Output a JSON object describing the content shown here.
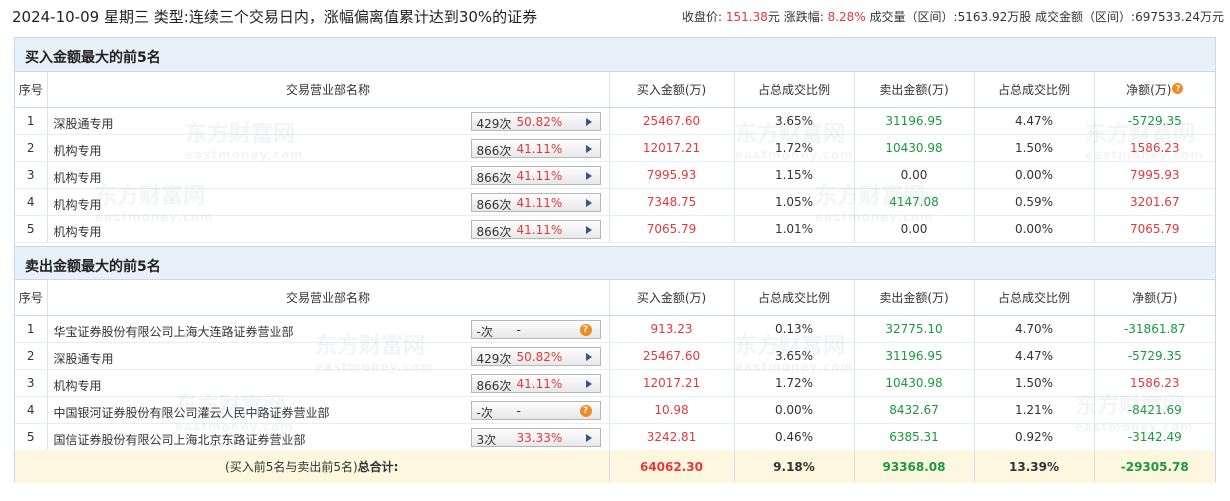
{
  "header": {
    "date": "2024-10-09",
    "weekday": "星期三",
    "type_label": "类型:",
    "type_text": "连续三个交易日内，涨幅偏离值累计达到30%的证券",
    "close_label": "收盘价:",
    "close_value": "151.38",
    "close_unit": "元",
    "change_label": "涨跌幅:",
    "change_value": "8.28%",
    "volume_label": "成交量（区间）:",
    "volume_value": "5163.92万股",
    "amount_label": "成交金额（区间）:",
    "amount_value": "697533.24万元"
  },
  "columns": {
    "index": "序号",
    "name": "交易营业部名称",
    "buy": "买入金额(万)",
    "buy_ratio": "占总成交比例",
    "sell": "卖出金额(万)",
    "sell_ratio": "占总成交比例",
    "net_buy_table": "净额(万)",
    "net_sell_table": "净额(万)"
  },
  "buy_section": {
    "title": "买入金额最大的前5名",
    "rows": [
      {
        "idx": "1",
        "name": "深股通专用",
        "count": "429次",
        "rate": "50.82%",
        "buy": "25467.60",
        "buy_ratio": "3.65%",
        "sell": "31196.95",
        "sell_ratio": "4.47%",
        "net": "-5729.35"
      },
      {
        "idx": "2",
        "name": "机构专用",
        "count": "866次",
        "rate": "41.11%",
        "buy": "12017.21",
        "buy_ratio": "1.72%",
        "sell": "10430.98",
        "sell_ratio": "1.50%",
        "net": "1586.23"
      },
      {
        "idx": "3",
        "name": "机构专用",
        "count": "866次",
        "rate": "41.11%",
        "buy": "7995.93",
        "buy_ratio": "1.15%",
        "sell": "0.00",
        "sell_ratio": "0.00%",
        "net": "7995.93"
      },
      {
        "idx": "4",
        "name": "机构专用",
        "count": "866次",
        "rate": "41.11%",
        "buy": "7348.75",
        "buy_ratio": "1.05%",
        "sell": "4147.08",
        "sell_ratio": "0.59%",
        "net": "3201.67"
      },
      {
        "idx": "5",
        "name": "机构专用",
        "count": "866次",
        "rate": "41.11%",
        "buy": "7065.79",
        "buy_ratio": "1.01%",
        "sell": "0.00",
        "sell_ratio": "0.00%",
        "net": "7065.79"
      }
    ]
  },
  "sell_section": {
    "title": "卖出金额最大的前5名",
    "rows": [
      {
        "idx": "1",
        "name": "华宝证券股份有限公司上海大连路证券营业部",
        "count": "-次",
        "rate": "-",
        "buy": "913.23",
        "buy_ratio": "0.13%",
        "sell": "32775.10",
        "sell_ratio": "4.70%",
        "net": "-31861.87"
      },
      {
        "idx": "2",
        "name": "深股通专用",
        "count": "429次",
        "rate": "50.82%",
        "buy": "25467.60",
        "buy_ratio": "3.65%",
        "sell": "31196.95",
        "sell_ratio": "4.47%",
        "net": "-5729.35"
      },
      {
        "idx": "3",
        "name": "机构专用",
        "count": "866次",
        "rate": "41.11%",
        "buy": "12017.21",
        "buy_ratio": "1.72%",
        "sell": "10430.98",
        "sell_ratio": "1.50%",
        "net": "1586.23"
      },
      {
        "idx": "4",
        "name": "中国银河证券股份有限公司灌云人民中路证券营业部",
        "count": "-次",
        "rate": "-",
        "buy": "10.98",
        "buy_ratio": "0.00%",
        "sell": "8432.67",
        "sell_ratio": "1.21%",
        "net": "-8421.69"
      },
      {
        "idx": "5",
        "name": "国信证券股份有限公司上海北京东路证券营业部",
        "count": "3次",
        "rate": "33.33%",
        "buy": "3242.81",
        "buy_ratio": "0.46%",
        "sell": "6385.31",
        "sell_ratio": "0.92%",
        "net": "-3142.49"
      }
    ]
  },
  "total": {
    "label_prefix": "(买入前5名与卖出前5名)",
    "label_bold": "总合计:",
    "buy": "64062.30",
    "buy_ratio": "9.18%",
    "sell": "93368.08",
    "sell_ratio": "13.39%",
    "net": "-29305.78"
  },
  "watermark": {
    "cn": "东方财富网",
    "en": "eastmoney.com"
  },
  "colors": {
    "up": "#e4393c",
    "down": "#1a9a3a",
    "header_bg": "#e8f0f9",
    "total_bg": "#fdf7df",
    "accent": "#f08a24"
  }
}
